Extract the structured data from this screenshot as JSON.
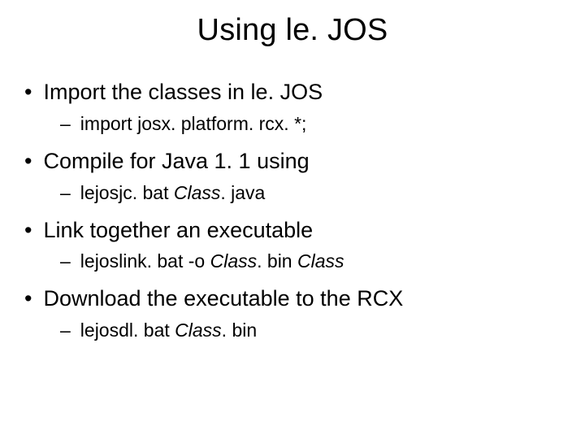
{
  "title": "Using le. JOS",
  "bullets": [
    {
      "text": "Import the classes in le. JOS",
      "sub": {
        "segments": [
          {
            "t": "import josx. platform. rcx. *;",
            "italic": false
          }
        ]
      }
    },
    {
      "text": "Compile for Java 1. 1 using",
      "sub": {
        "segments": [
          {
            "t": "lejosjc. bat ",
            "italic": false
          },
          {
            "t": "Class",
            "italic": true
          },
          {
            "t": ". java",
            "italic": false
          }
        ]
      }
    },
    {
      "text": "Link together an executable",
      "sub": {
        "segments": [
          {
            "t": "lejoslink. bat -o ",
            "italic": false
          },
          {
            "t": "Class",
            "italic": true
          },
          {
            "t": ". bin ",
            "italic": false
          },
          {
            "t": "Class",
            "italic": true
          }
        ]
      }
    },
    {
      "text": "Download the executable to the RCX",
      "sub": {
        "segments": [
          {
            "t": "lejosdl. bat ",
            "italic": false
          },
          {
            "t": "Class",
            "italic": true
          },
          {
            "t": ". bin",
            "italic": false
          }
        ]
      }
    }
  ]
}
